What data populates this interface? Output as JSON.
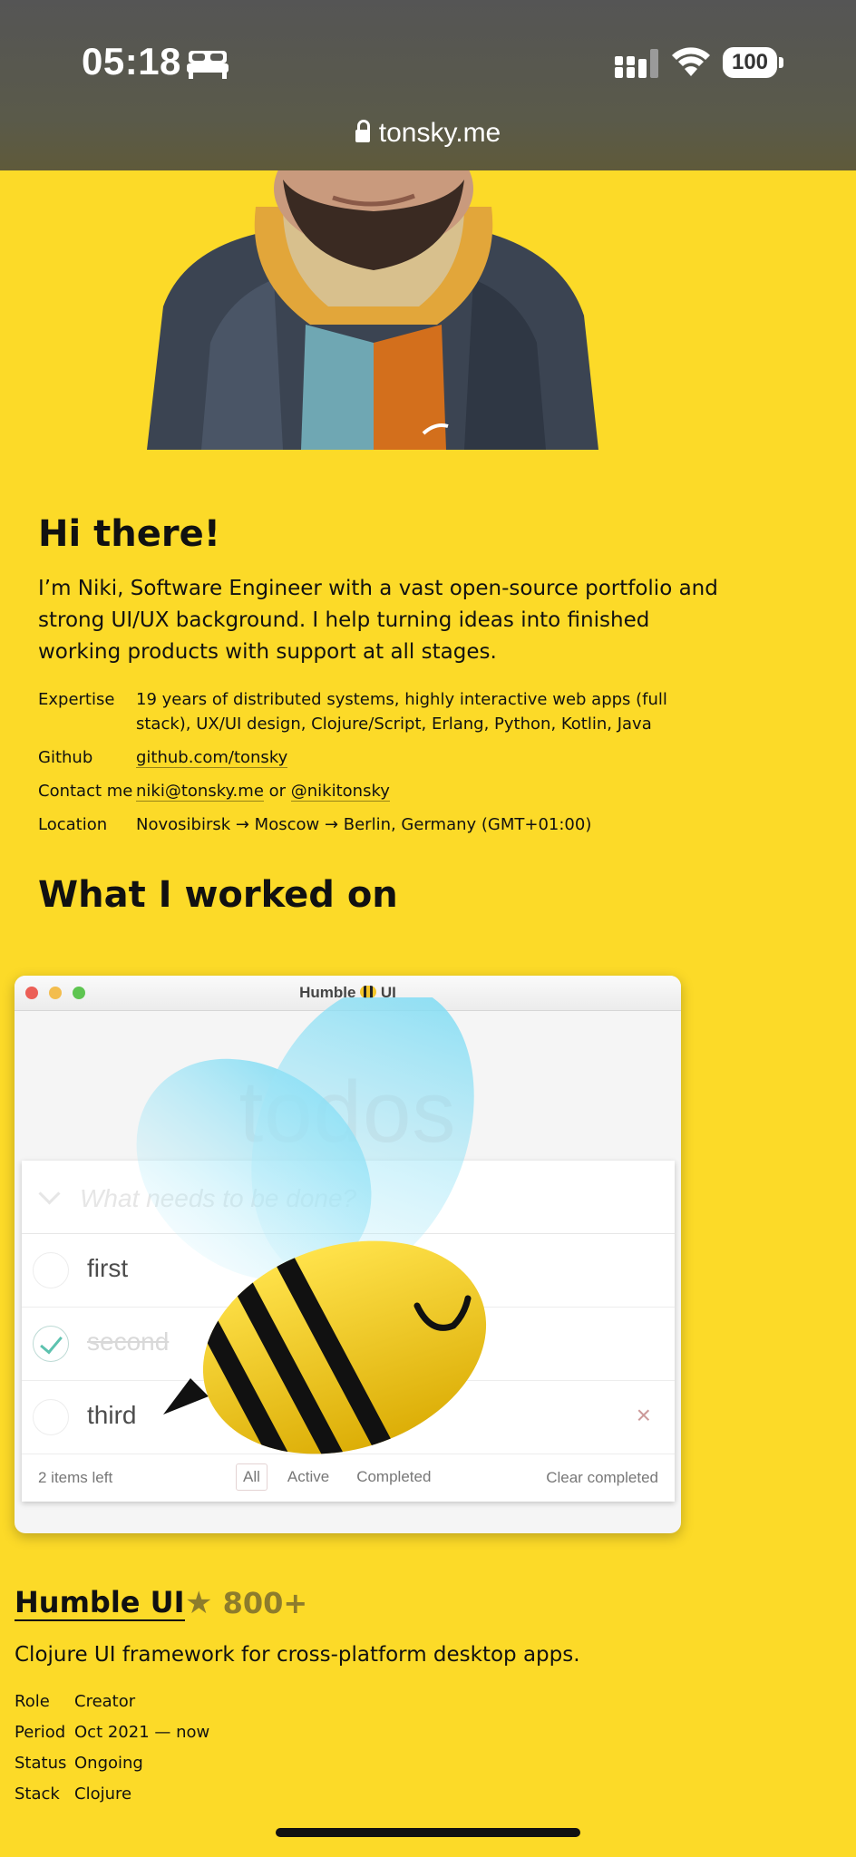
{
  "status_bar": {
    "time": "05:18",
    "battery": "100",
    "url": "tonsky.me",
    "icons": [
      "bed-icon",
      "signal-icon",
      "wifi-icon",
      "battery-icon",
      "lock-icon"
    ]
  },
  "intro": {
    "heading": "Hi there!",
    "text": "I’m Niki, Software Engineer with a vast open-source portfolio and strong UI/UX background. I help turning ideas into finished working products with support at all stages."
  },
  "facts": {
    "expertise_label": "Expertise",
    "expertise_value": "19 years of distributed systems, highly interactive web apps (full stack), UX/UI design, Clojure/Script, Erlang, Python, Kotlin, Java",
    "github_label": "Github",
    "github_link": "github.com/tonsky",
    "contact_label": "Contact me",
    "contact_email": "niki@tonsky.me",
    "contact_or": " or ",
    "contact_handle": "@nikitonsky",
    "location_label": "Location",
    "location_value": "Novosibirsk → Moscow → Berlin, Germany (GMT+01:00)"
  },
  "worked_heading": "What I worked on",
  "project_window": {
    "title_left": "Humble",
    "title_right": "UI",
    "todos_heading": "todos",
    "placeholder": "What needs to be done?",
    "items": [
      {
        "label": "first",
        "done": false
      },
      {
        "label": "second",
        "done": true
      },
      {
        "label": "third",
        "done": false
      }
    ],
    "delete_glyph": "×",
    "items_left": "2 items left",
    "filter_all": "All",
    "filter_active": "Active",
    "filter_completed": "Completed",
    "clear_completed": "Clear completed"
  },
  "project": {
    "name": "Humble UI",
    "stars": "800+",
    "description": "Clojure UI framework for cross-platform desktop apps.",
    "role_label": "Role",
    "role": "Creator",
    "period_label": "Period",
    "period": "Oct 2021 — now",
    "status_label": "Status",
    "status": "Ongoing",
    "stack_label": "Stack",
    "stack": "Clojure"
  },
  "colors": {
    "page_bg": "#FCDA28",
    "star_color": "#8d7c2c",
    "check_color": "#5dc2af"
  }
}
